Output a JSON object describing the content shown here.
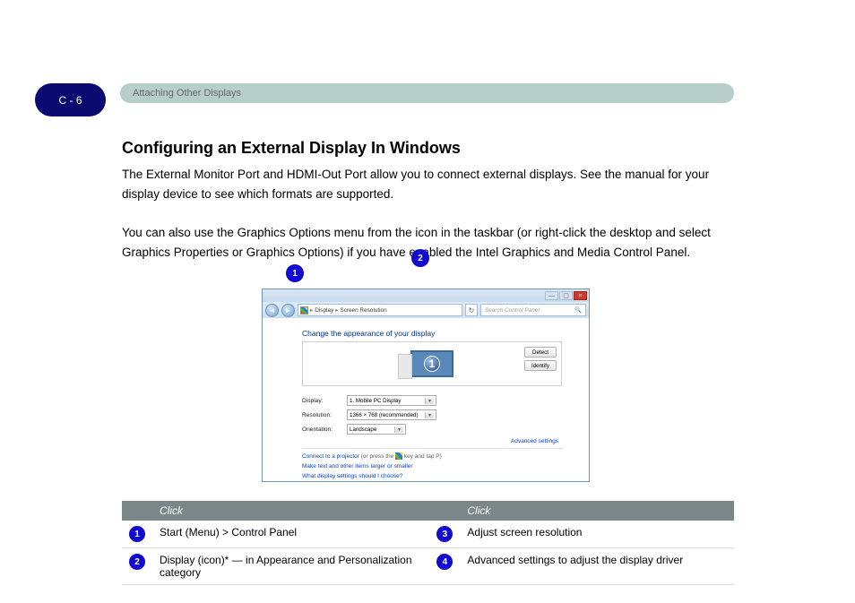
{
  "page": {
    "badge": "C - 6",
    "header": "Attaching Other Displays"
  },
  "section_title": "Configuring an External Display In Windows",
  "paragraph1": "The External Monitor Port and HDMI-Out Port allow you to connect external displays. See the manual for your display device to see which formats are supported.",
  "paragraph2": "You can also use the Graphics Options menu from the icon in the taskbar (or right-click the desktop and select Graphics Properties or Graphics Options) if you have enabled the Intel Graphics and Media Control Panel.",
  "callouts": {
    "one": "1",
    "two": "2",
    "three": "3",
    "four": "4"
  },
  "window": {
    "titlebar": {
      "min": "—",
      "max": "▢",
      "close": "×"
    },
    "addrbar": {
      "back": "◄",
      "fwd": "►",
      "crumb1": "Display",
      "crumb2": "Screen Resolution",
      "sep": "▸",
      "refresh": "↻",
      "search_placeholder": "Search Control Panel",
      "magnifier": "🔍"
    },
    "heading": "Change the appearance of your display",
    "preview_number": "1",
    "buttons": {
      "detect": "Detect",
      "identify": "Identify"
    },
    "settings": {
      "display_label": "Display:",
      "display_value": "1. Mobile PC Display",
      "resolution_label": "Resolution:",
      "resolution_value": "1366 × 768 (recommended)",
      "orientation_label": "Orientation:",
      "orientation_value": "Landscape"
    },
    "advanced": "Advanced settings",
    "links": {
      "projector_a": "Connect to a projector",
      "projector_b": " (or press the ",
      "projector_c": " key and tap P)",
      "larger": "Make text and other items larger or smaller",
      "choose": "What display settings should I choose?"
    }
  },
  "table": {
    "headers": [
      "",
      "Click",
      "",
      "Click"
    ],
    "rows": [
      [
        "1",
        "Start (Menu) > Control Panel",
        "3",
        "Adjust screen resolution"
      ],
      [
        "2",
        "Display (icon)* — in Appearance and Personalization category",
        "4",
        "Advanced settings to adjust the display driver"
      ]
    ]
  }
}
